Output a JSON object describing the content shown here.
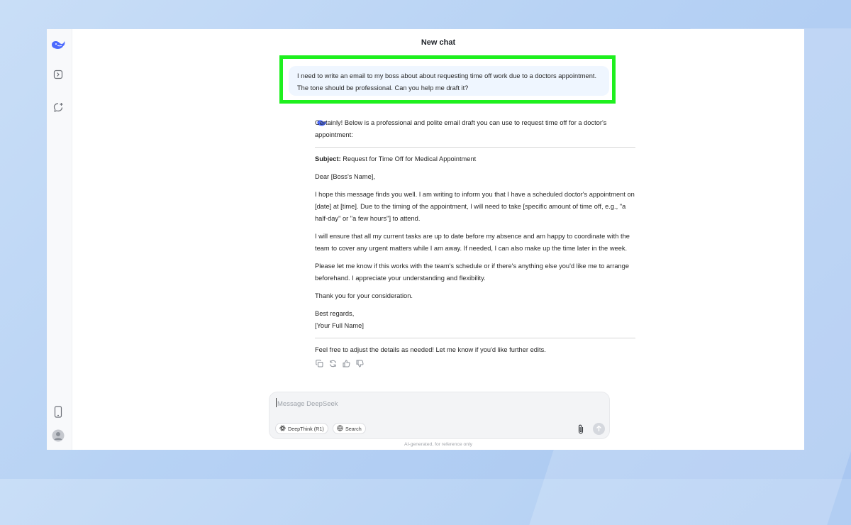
{
  "header": {
    "title": "New chat"
  },
  "user_message": "I need to write an email to my boss about about requesting time off work due to a doctors appointment. The tone should be professional. Can you help me draft it?",
  "assistant": {
    "intro": "Certainly! Below is a professional and polite email draft you can use to request time off for a doctor's appointment:",
    "subject_label": "Subject:",
    "subject_text": " Request for Time Off for Medical Appointment",
    "greeting": "Dear [Boss's Name],",
    "p1": "I hope this message finds you well. I am writing to inform you that I have a scheduled doctor's appointment on [date] at [time]. Due to the timing of the appointment, I will need to take [specific amount of time off, e.g., \"a half-day\" or \"a few hours\"] to attend.",
    "p2": "I will ensure that all my current tasks are up to date before my absence and am happy to coordinate with the team to cover any urgent matters while I am away. If needed, I can also make up the time later in the week.",
    "p3": "Please let me know if this works with the team's schedule or if there's anything else you'd like me to arrange beforehand. I appreciate your understanding and flexibility.",
    "p4": "Thank you for your consideration.",
    "signoff": "Best regards,",
    "signature": "[Your Full Name]",
    "outro": "Feel free to adjust the details as needed! Let me know if you'd like further edits."
  },
  "composer": {
    "placeholder": "Message DeepSeek",
    "deepthink_label": "DeepThink (R1)",
    "search_label": "Search"
  },
  "footer": {
    "disclaimer": "AI-generated, for reference only"
  },
  "colors": {
    "brand": "#4d6bfe",
    "highlight_border": "#1ef01e",
    "user_bubble": "#eff6ff"
  },
  "icons": {
    "logo": "whale-logo-icon",
    "sidebar_toggle": "sidebar-toggle-icon",
    "new_chat": "new-chat-icon",
    "mobile": "mobile-app-icon",
    "profile": "user-profile-icon",
    "copy": "copy-icon",
    "regenerate": "regenerate-icon",
    "like": "thumbs-up-icon",
    "dislike": "thumbs-down-icon",
    "attach": "paperclip-icon",
    "send": "send-arrow-icon"
  }
}
